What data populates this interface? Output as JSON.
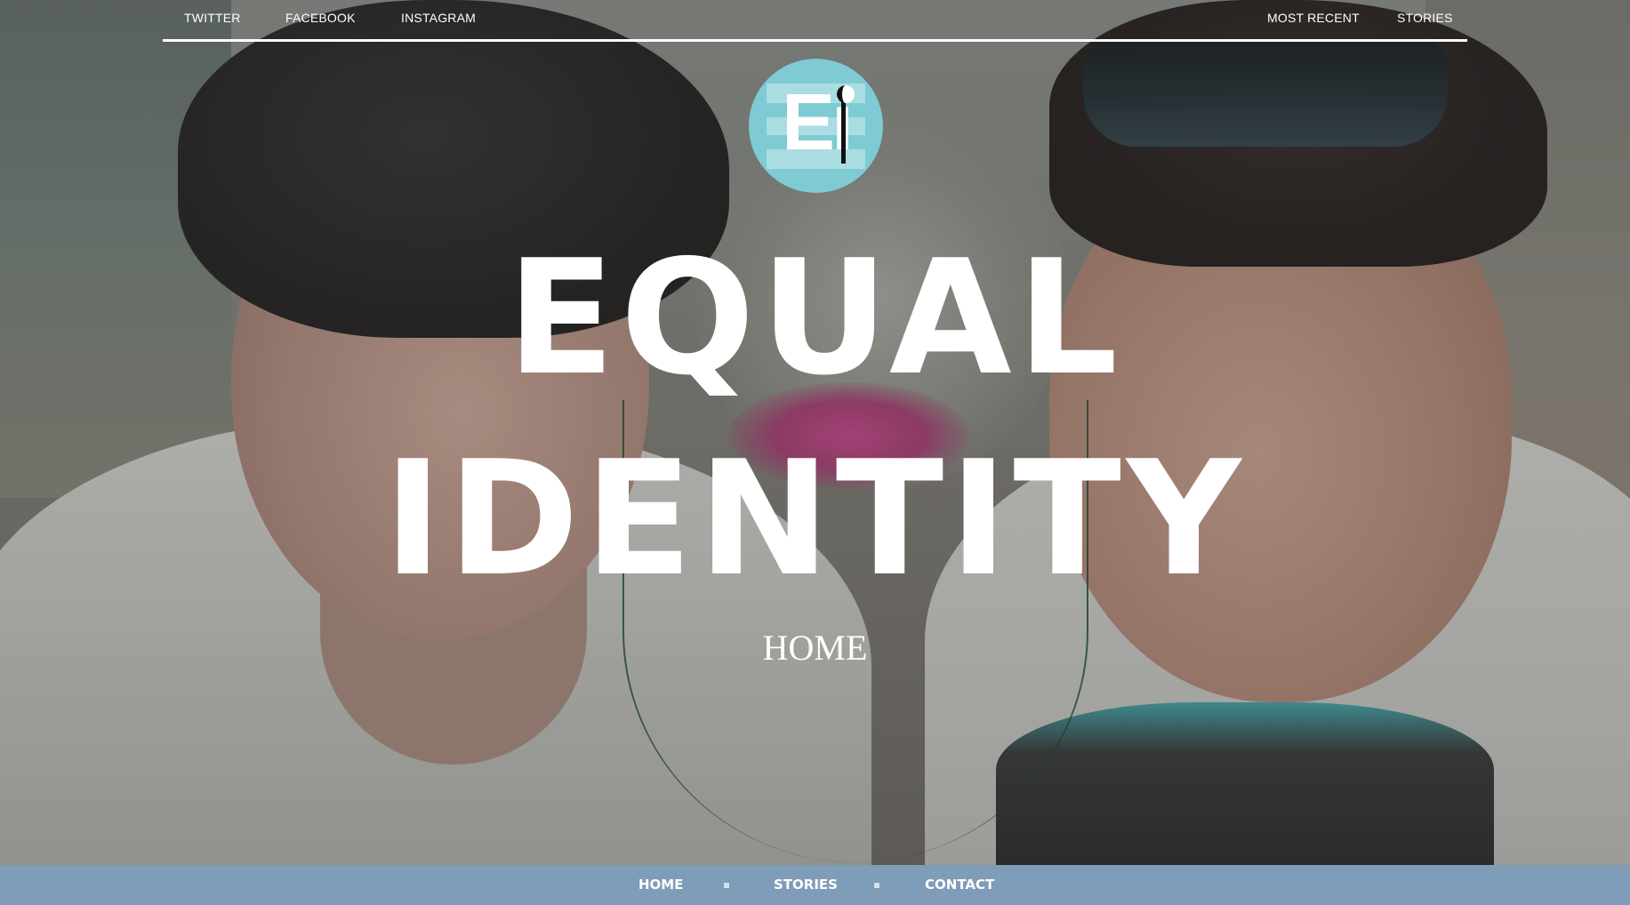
{
  "top_nav": {
    "left_links": [
      "TWITTER",
      "FACEBOOK",
      "INSTAGRAM"
    ],
    "right_links": [
      "MOST RECENT",
      "STORIES"
    ]
  },
  "logo": {
    "text": "Ei",
    "colors": {
      "circle": "#7fcbd3",
      "band": "#a9dde2",
      "letter": "#ffffff",
      "accent": "#111111"
    }
  },
  "hero": {
    "title_line_1": "EQUAL",
    "title_line_2": "IDENTITY",
    "subtitle": "HOME",
    "background_image": "two-smiling-boys-sharing-earbuds"
  },
  "bottom_nav": {
    "links": [
      "HOME",
      "STORIES",
      "CONTACT"
    ],
    "background_color": "#7f9cb8"
  }
}
